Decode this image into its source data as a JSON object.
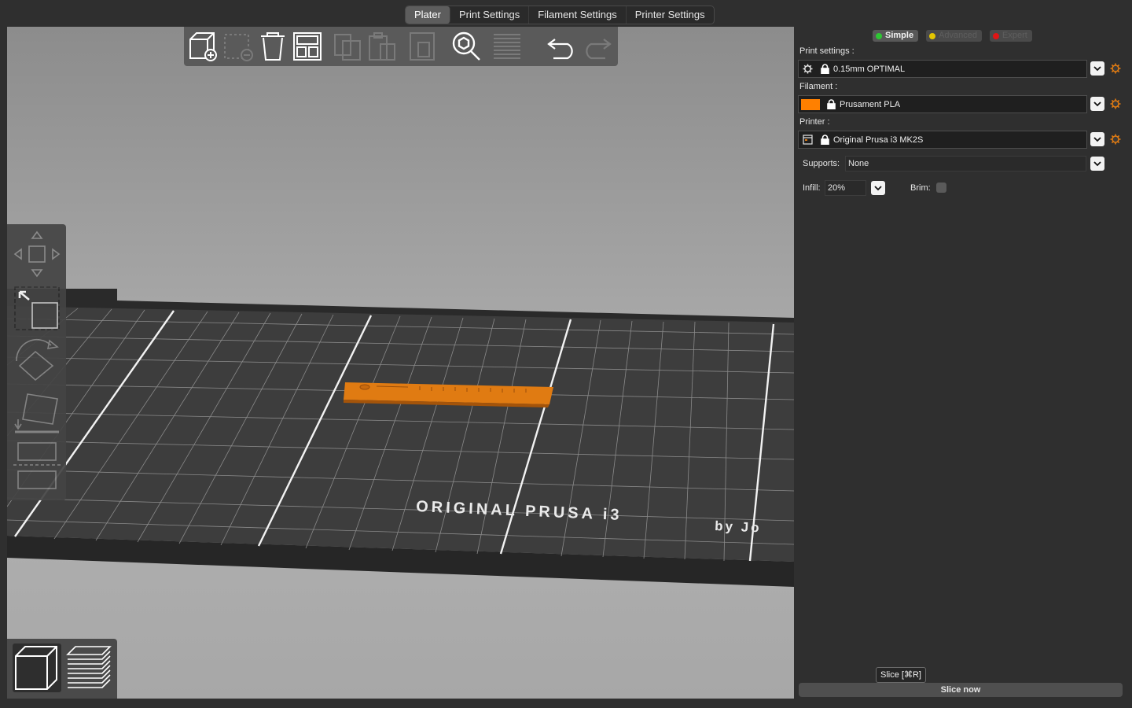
{
  "tabs": [
    {
      "label": "Plater",
      "active": true
    },
    {
      "label": "Print Settings",
      "active": false
    },
    {
      "label": "Filament Settings",
      "active": false
    },
    {
      "label": "Printer Settings",
      "active": false
    }
  ],
  "toolbar": {
    "items": [
      "add-icon",
      "delete-icon",
      "delete-all-icon",
      "arrange-icon",
      "copy-icon",
      "paste-icon",
      "instance-icon",
      "search-icon",
      "layers-icon",
      "undo-icon",
      "redo-icon"
    ]
  },
  "bed": {
    "label_main": "ORIGINAL PRUSA i3",
    "label_sub": "by Jo"
  },
  "model": {
    "color": "#e07b12"
  },
  "modes": [
    {
      "label": "Simple",
      "color": "#2ec733",
      "active": true
    },
    {
      "label": "Advanced",
      "color": "#e5c700",
      "active": false
    },
    {
      "label": "Expert",
      "color": "#e01515",
      "active": false
    }
  ],
  "print_settings": {
    "label": "Print settings :",
    "value": "0.15mm OPTIMAL"
  },
  "filament": {
    "label": "Filament :",
    "value": "Prusament PLA",
    "color": "#ff8000"
  },
  "printer": {
    "label": "Printer :",
    "value": "Original Prusa i3 MK2S"
  },
  "supports": {
    "label": "Supports:",
    "value": "None"
  },
  "infill": {
    "label": "Infill:",
    "value": "20%"
  },
  "brim": {
    "label": "Brim:",
    "checked": false
  },
  "slice": {
    "tooltip": "Slice [⌘R]",
    "button_label": "Slice now"
  }
}
